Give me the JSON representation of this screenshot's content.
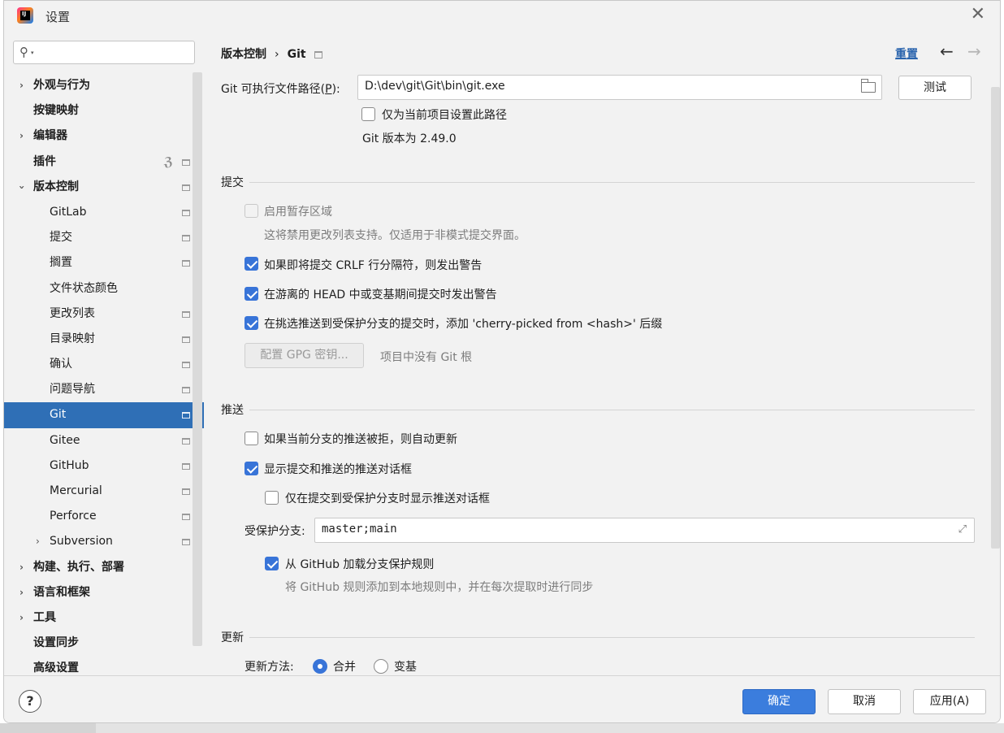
{
  "window": {
    "title": "设置",
    "icon_text": "IJ"
  },
  "sidebar": {
    "search_placeholder": "",
    "items": [
      {
        "label": "外观与行为"
      },
      {
        "label": "按键映射"
      },
      {
        "label": "编辑器"
      },
      {
        "label": "插件"
      },
      {
        "label": "版本控制"
      },
      {
        "label": "GitLab"
      },
      {
        "label": "提交"
      },
      {
        "label": "搁置"
      },
      {
        "label": "文件状态颜色"
      },
      {
        "label": "更改列表"
      },
      {
        "label": "目录映射"
      },
      {
        "label": "确认"
      },
      {
        "label": "问题导航"
      },
      {
        "label": "Git"
      },
      {
        "label": "Gitee"
      },
      {
        "label": "GitHub"
      },
      {
        "label": "Mercurial"
      },
      {
        "label": "Perforce"
      },
      {
        "label": "Subversion"
      },
      {
        "label": "构建、执行、部署"
      },
      {
        "label": "语言和框架"
      },
      {
        "label": "工具"
      },
      {
        "label": "设置同步"
      },
      {
        "label": "高级设置"
      }
    ],
    "selected": "Git"
  },
  "header": {
    "breadcrumb_parent": "版本控制",
    "breadcrumb_sep": "›",
    "breadcrumb_current": "Git",
    "reset_label": "重置",
    "back_icon": "←",
    "forward_icon": "→"
  },
  "git": {
    "exe_label_prefix": "Git 可执行文件路径(",
    "exe_label_mnemonic": "P",
    "exe_label_suffix": "):",
    "exe_path": "D:\\dev\\git\\Git\\bin\\git.exe",
    "test_button": "测试",
    "project_only_label": "仅为当前项目设置此路径",
    "project_only_checked": false,
    "version_text": "Git 版本为 2.49.0"
  },
  "commit": {
    "section_title": "提交",
    "staging_label": "启用暂存区域",
    "staging_checked": false,
    "staging_hint": "这将禁用更改列表支持。仅适用于非模式提交界面。",
    "crlf_label": "如果即将提交 CRLF 行分隔符，则发出警告",
    "crlf_checked": true,
    "detached_label": "在游离的 HEAD 中或变基期间提交时发出警告",
    "detached_checked": true,
    "cherry_label": "在挑选推送到受保护分支的提交时，添加 'cherry-picked from <hash>' 后缀",
    "cherry_checked": true,
    "gpg_button": "配置 GPG 密钥...",
    "gpg_hint": "项目中没有 Git 根"
  },
  "push": {
    "section_title": "推送",
    "auto_update_label": "如果当前分支的推送被拒，则自动更新",
    "auto_update_checked": false,
    "show_dialog_label": "显示提交和推送的推送对话框",
    "show_dialog_checked": true,
    "protected_only_label": "仅在提交到受保护分支时显示推送对话框",
    "protected_only_checked": false,
    "protected_branches_label": "受保护分支:",
    "protected_branches_value": "master;main",
    "github_rules_label": "从 GitHub 加载分支保护规则",
    "github_rules_checked": true,
    "github_rules_hint": "将 GitHub 规则添加到本地规则中，并在每次提取时进行同步"
  },
  "update": {
    "section_title": "更新",
    "method_label": "更新方法:",
    "options": [
      "合并",
      "变基"
    ],
    "selected": "合并"
  },
  "footer": {
    "help_icon": "?",
    "ok_button": "确定",
    "cancel_button": "取消",
    "apply_button": "应用(A)"
  },
  "colors": {
    "selection": "#2f6fb6",
    "accent": "#3874d8",
    "link": "#2a64ad",
    "background": "#f2f2f2"
  }
}
